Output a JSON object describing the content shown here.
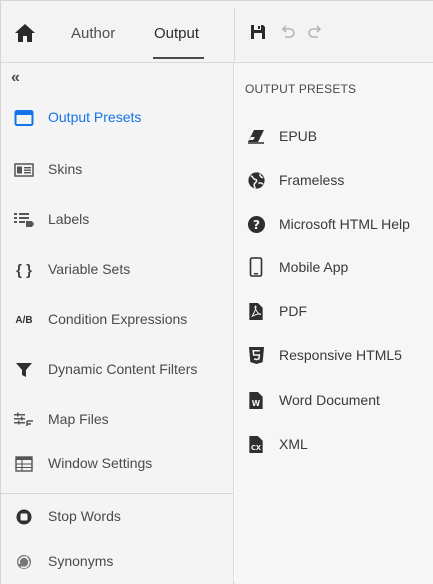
{
  "top": {
    "tabs": [
      {
        "label": "Author"
      },
      {
        "label": "Output",
        "active": true
      }
    ]
  },
  "nav": {
    "collapse_glyph": "«",
    "items": [
      {
        "label": "Output Presets",
        "icon": "window-icon",
        "active": true
      },
      {
        "label": "Skins",
        "icon": "skins-icon"
      },
      {
        "label": "Labels",
        "icon": "labels-icon"
      },
      {
        "label": "Variable Sets",
        "icon": "braces-icon",
        "glyph": "{ }"
      },
      {
        "label": "Condition Expressions",
        "icon": "condition-icon",
        "glyph": "A/B"
      },
      {
        "label": "Dynamic Content Filters",
        "icon": "filter-icon"
      },
      {
        "label": "Map Files",
        "icon": "map-files-icon"
      },
      {
        "label": "Window Settings",
        "icon": "window-settings-icon"
      },
      {
        "label": "Stop Words",
        "icon": "stop-icon"
      },
      {
        "label": "Synonyms",
        "icon": "synonyms-icon"
      }
    ]
  },
  "presets": {
    "title": "OUTPUT PRESETS",
    "items": [
      {
        "label": "EPUB",
        "icon": "eraser-icon"
      },
      {
        "label": "Frameless",
        "icon": "globe-icon"
      },
      {
        "label": "Microsoft HTML Help",
        "icon": "help-icon"
      },
      {
        "label": "Mobile App",
        "icon": "mobile-icon"
      },
      {
        "label": "PDF",
        "icon": "pdf-icon"
      },
      {
        "label": "Responsive HTML5",
        "icon": "html5-icon"
      },
      {
        "label": "Word Document",
        "icon": "word-icon"
      },
      {
        "label": "XML",
        "icon": "xml-icon"
      }
    ]
  },
  "colors": {
    "accent": "#1473e6",
    "text": "#4a4a4a",
    "panel": "#f4f4f4"
  }
}
